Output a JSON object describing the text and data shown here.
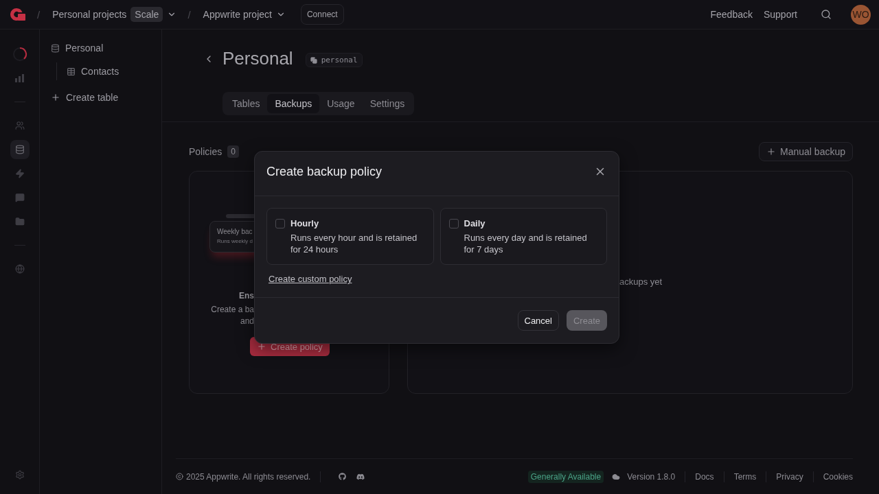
{
  "top_bar": {
    "breadcrumbs": [
      {
        "separator": "/",
        "label": "Personal projects",
        "badge": "Scale"
      },
      {
        "separator": "/",
        "label": "Appwrite project"
      }
    ],
    "connect": "Connect",
    "links": [
      "Feedback",
      "Support"
    ],
    "avatar": "WO"
  },
  "rail": [
    {
      "kind": "progress",
      "selected": false
    },
    {
      "kind": "chart",
      "selected": false
    },
    {
      "kind": "divider"
    },
    {
      "kind": "users",
      "selected": false
    },
    {
      "kind": "database",
      "selected": true
    },
    {
      "kind": "bolt",
      "selected": false
    },
    {
      "kind": "chat",
      "selected": false
    },
    {
      "kind": "folder",
      "selected": false
    },
    {
      "kind": "divider"
    },
    {
      "kind": "globe",
      "selected": false
    }
  ],
  "sidebar": {
    "database": "Personal",
    "tables": [
      "Contacts"
    ],
    "create": "Create table"
  },
  "header": {
    "title": "Personal",
    "id_badge": "personal",
    "tabs": [
      {
        "label": "Tables",
        "selected": false
      },
      {
        "label": "Backups",
        "selected": true
      },
      {
        "label": "Usage",
        "selected": false
      },
      {
        "label": "Settings",
        "selected": false
      }
    ]
  },
  "policies": {
    "title": "Policies",
    "count": "0",
    "preview": {
      "title": "Weekly bac",
      "subtitle": "Runs weekly d"
    },
    "empty_title": "Ens",
    "empty_lines": [
      "Create a ba",
      "and"
    ],
    "create_button": "Create policy"
  },
  "backups": {
    "manual": "Manual backup",
    "empty": "ackups yet"
  },
  "modal": {
    "title": "Create backup policy",
    "options": [
      {
        "title": "Hourly",
        "description": "Runs every hour and is retained for 24 hours",
        "checked": false
      },
      {
        "title": "Daily",
        "description": "Runs every day and is retained for 7 days",
        "checked": false
      }
    ],
    "custom_link": "Create custom policy",
    "cancel": "Cancel",
    "create": "Create",
    "create_disabled": true
  },
  "footer": {
    "copyright": "2025 Appwrite. All rights reserved.",
    "status": "Generally Available",
    "version": "Version 1.8.0",
    "links": [
      "Docs",
      "Terms",
      "Privacy",
      "Cookies"
    ]
  }
}
